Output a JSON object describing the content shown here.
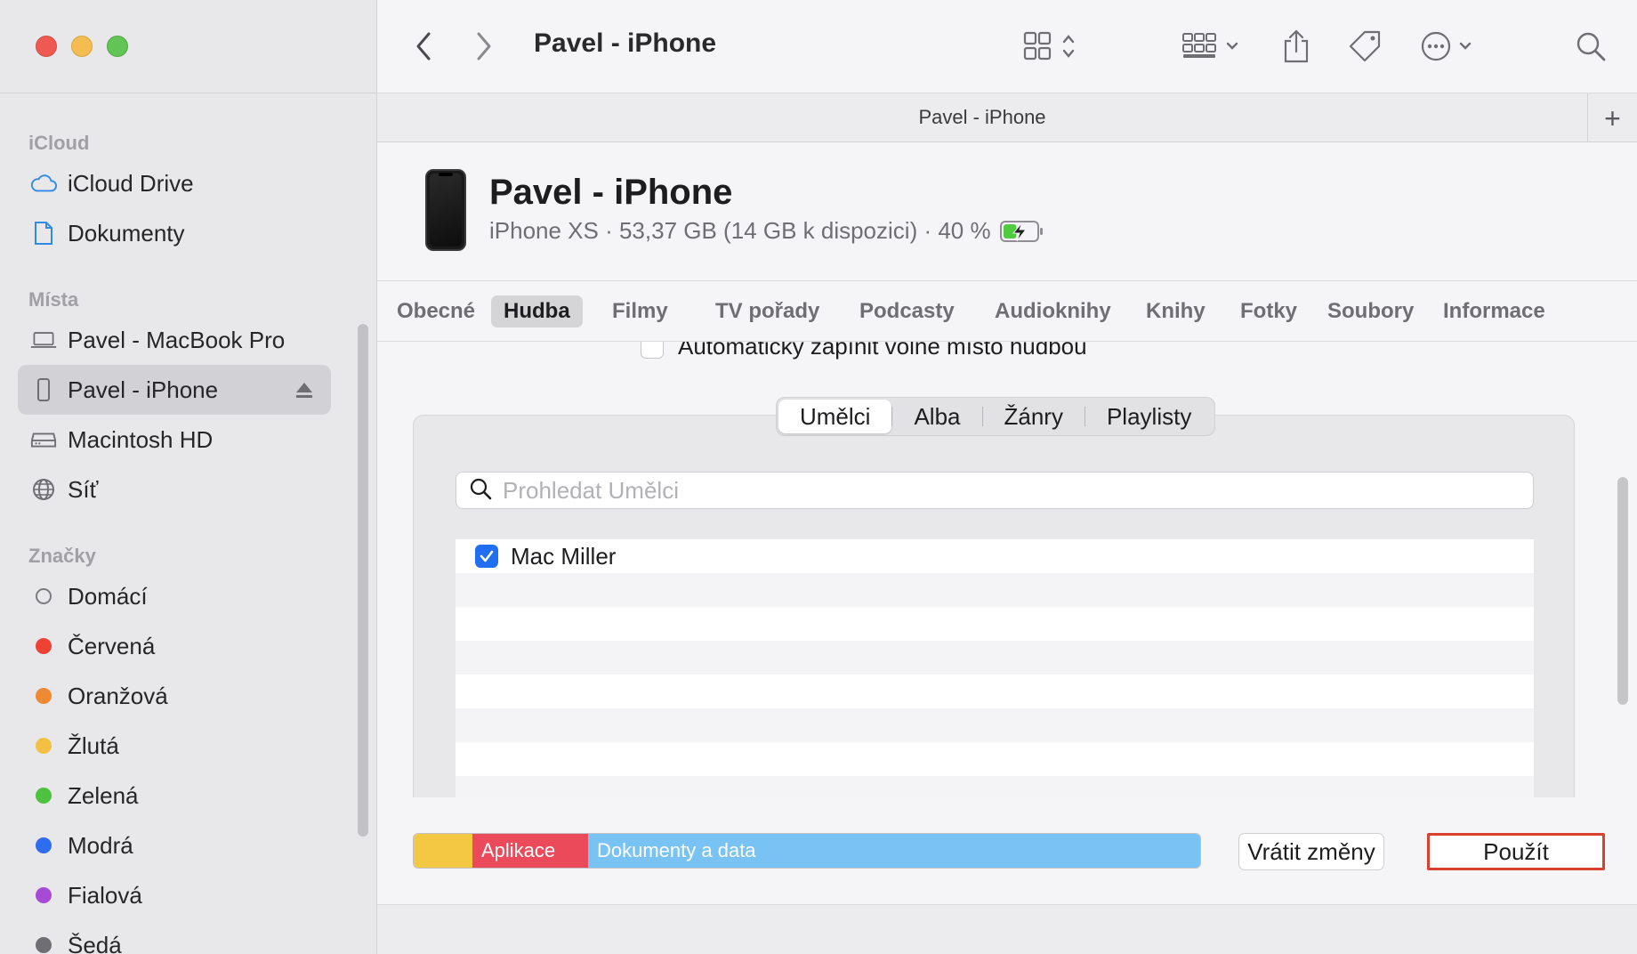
{
  "window": {
    "title": "Pavel - iPhone",
    "tab_title": "Pavel - iPhone",
    "new_tab": "+"
  },
  "sidebar": {
    "sections": [
      {
        "label": "iCloud"
      },
      {
        "label": "Místa"
      },
      {
        "label": "Značky"
      }
    ],
    "icloud_items": [
      {
        "label": "iCloud Drive",
        "icon": "cloud-icon"
      },
      {
        "label": "Dokumenty",
        "icon": "document-icon"
      }
    ],
    "places_items": [
      {
        "label": "Pavel - MacBook Pro",
        "icon": "laptop-icon"
      },
      {
        "label": "Pavel - iPhone",
        "icon": "iphone-icon",
        "selected": true
      },
      {
        "label": "Macintosh HD",
        "icon": "disk-icon"
      },
      {
        "label": "Síť",
        "icon": "globe-icon"
      }
    ],
    "tags": [
      {
        "label": "Domácí",
        "color": "hollow"
      },
      {
        "label": "Červená",
        "color": "#ee4235"
      },
      {
        "label": "Oranžová",
        "color": "#ef8a34"
      },
      {
        "label": "Žlutá",
        "color": "#f3c043"
      },
      {
        "label": "Zelená",
        "color": "#4fc140"
      },
      {
        "label": "Modrá",
        "color": "#2e6cf0"
      },
      {
        "label": "Fialová",
        "color": "#a74bd6"
      },
      {
        "label": "Šedá",
        "color": "#6f6e72"
      }
    ]
  },
  "device": {
    "name": "Pavel - iPhone",
    "info": "iPhone XS · 53,37 GB (14 GB k dispozici) · 40 %",
    "battery_level": 0.4
  },
  "categories": [
    {
      "label": "Obecné"
    },
    {
      "label": "Hudba",
      "active": true
    },
    {
      "label": "Filmy"
    },
    {
      "label": "TV pořady"
    },
    {
      "label": "Podcasty"
    },
    {
      "label": "Audioknihy"
    },
    {
      "label": "Knihy"
    },
    {
      "label": "Fotky"
    },
    {
      "label": "Soubory"
    },
    {
      "label": "Informace"
    }
  ],
  "music": {
    "auto_fill_label": "Automaticky zapínit volné místo hudbou",
    "segments": [
      {
        "label": "Umělci",
        "active": true
      },
      {
        "label": "Alba"
      },
      {
        "label": "Žánry"
      },
      {
        "label": "Playlisty"
      }
    ],
    "search_placeholder": "Prohledat Umělci",
    "artists": [
      {
        "label": "Mac Miller",
        "checked": true
      }
    ]
  },
  "storage": {
    "segments": [
      {
        "label": "",
        "color": "#f5c843"
      },
      {
        "label": "Aplikace",
        "color": "#ea4a5a"
      },
      {
        "label": "Dokumenty a data",
        "color": "#79c3f4"
      }
    ]
  },
  "footer": {
    "revert_label": "Vrátit změny",
    "apply_label": "Použít"
  }
}
